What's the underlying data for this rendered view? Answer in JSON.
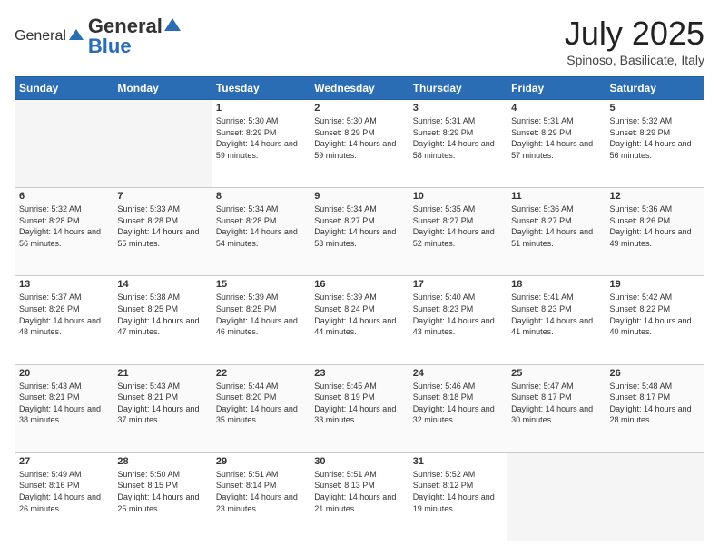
{
  "header": {
    "logo_general": "General",
    "logo_blue": "Blue",
    "month": "July 2025",
    "location": "Spinoso, Basilicate, Italy"
  },
  "days_of_week": [
    "Sunday",
    "Monday",
    "Tuesday",
    "Wednesday",
    "Thursday",
    "Friday",
    "Saturday"
  ],
  "weeks": [
    [
      {
        "day": "",
        "empty": true
      },
      {
        "day": "",
        "empty": true
      },
      {
        "day": "1",
        "sunrise": "5:30 AM",
        "sunset": "8:29 PM",
        "daylight": "14 hours and 59 minutes."
      },
      {
        "day": "2",
        "sunrise": "5:30 AM",
        "sunset": "8:29 PM",
        "daylight": "14 hours and 59 minutes."
      },
      {
        "day": "3",
        "sunrise": "5:31 AM",
        "sunset": "8:29 PM",
        "daylight": "14 hours and 58 minutes."
      },
      {
        "day": "4",
        "sunrise": "5:31 AM",
        "sunset": "8:29 PM",
        "daylight": "14 hours and 57 minutes."
      },
      {
        "day": "5",
        "sunrise": "5:32 AM",
        "sunset": "8:29 PM",
        "daylight": "14 hours and 56 minutes."
      }
    ],
    [
      {
        "day": "6",
        "sunrise": "5:32 AM",
        "sunset": "8:28 PM",
        "daylight": "14 hours and 56 minutes."
      },
      {
        "day": "7",
        "sunrise": "5:33 AM",
        "sunset": "8:28 PM",
        "daylight": "14 hours and 55 minutes."
      },
      {
        "day": "8",
        "sunrise": "5:34 AM",
        "sunset": "8:28 PM",
        "daylight": "14 hours and 54 minutes."
      },
      {
        "day": "9",
        "sunrise": "5:34 AM",
        "sunset": "8:27 PM",
        "daylight": "14 hours and 53 minutes."
      },
      {
        "day": "10",
        "sunrise": "5:35 AM",
        "sunset": "8:27 PM",
        "daylight": "14 hours and 52 minutes."
      },
      {
        "day": "11",
        "sunrise": "5:36 AM",
        "sunset": "8:27 PM",
        "daylight": "14 hours and 51 minutes."
      },
      {
        "day": "12",
        "sunrise": "5:36 AM",
        "sunset": "8:26 PM",
        "daylight": "14 hours and 49 minutes."
      }
    ],
    [
      {
        "day": "13",
        "sunrise": "5:37 AM",
        "sunset": "8:26 PM",
        "daylight": "14 hours and 48 minutes."
      },
      {
        "day": "14",
        "sunrise": "5:38 AM",
        "sunset": "8:25 PM",
        "daylight": "14 hours and 47 minutes."
      },
      {
        "day": "15",
        "sunrise": "5:39 AM",
        "sunset": "8:25 PM",
        "daylight": "14 hours and 46 minutes."
      },
      {
        "day": "16",
        "sunrise": "5:39 AM",
        "sunset": "8:24 PM",
        "daylight": "14 hours and 44 minutes."
      },
      {
        "day": "17",
        "sunrise": "5:40 AM",
        "sunset": "8:23 PM",
        "daylight": "14 hours and 43 minutes."
      },
      {
        "day": "18",
        "sunrise": "5:41 AM",
        "sunset": "8:23 PM",
        "daylight": "14 hours and 41 minutes."
      },
      {
        "day": "19",
        "sunrise": "5:42 AM",
        "sunset": "8:22 PM",
        "daylight": "14 hours and 40 minutes."
      }
    ],
    [
      {
        "day": "20",
        "sunrise": "5:43 AM",
        "sunset": "8:21 PM",
        "daylight": "14 hours and 38 minutes."
      },
      {
        "day": "21",
        "sunrise": "5:43 AM",
        "sunset": "8:21 PM",
        "daylight": "14 hours and 37 minutes."
      },
      {
        "day": "22",
        "sunrise": "5:44 AM",
        "sunset": "8:20 PM",
        "daylight": "14 hours and 35 minutes."
      },
      {
        "day": "23",
        "sunrise": "5:45 AM",
        "sunset": "8:19 PM",
        "daylight": "14 hours and 33 minutes."
      },
      {
        "day": "24",
        "sunrise": "5:46 AM",
        "sunset": "8:18 PM",
        "daylight": "14 hours and 32 minutes."
      },
      {
        "day": "25",
        "sunrise": "5:47 AM",
        "sunset": "8:17 PM",
        "daylight": "14 hours and 30 minutes."
      },
      {
        "day": "26",
        "sunrise": "5:48 AM",
        "sunset": "8:17 PM",
        "daylight": "14 hours and 28 minutes."
      }
    ],
    [
      {
        "day": "27",
        "sunrise": "5:49 AM",
        "sunset": "8:16 PM",
        "daylight": "14 hours and 26 minutes."
      },
      {
        "day": "28",
        "sunrise": "5:50 AM",
        "sunset": "8:15 PM",
        "daylight": "14 hours and 25 minutes."
      },
      {
        "day": "29",
        "sunrise": "5:51 AM",
        "sunset": "8:14 PM",
        "daylight": "14 hours and 23 minutes."
      },
      {
        "day": "30",
        "sunrise": "5:51 AM",
        "sunset": "8:13 PM",
        "daylight": "14 hours and 21 minutes."
      },
      {
        "day": "31",
        "sunrise": "5:52 AM",
        "sunset": "8:12 PM",
        "daylight": "14 hours and 19 minutes."
      },
      {
        "day": "",
        "empty": true
      },
      {
        "day": "",
        "empty": true
      }
    ]
  ],
  "labels": {
    "sunrise": "Sunrise:",
    "sunset": "Sunset:",
    "daylight": "Daylight:"
  }
}
